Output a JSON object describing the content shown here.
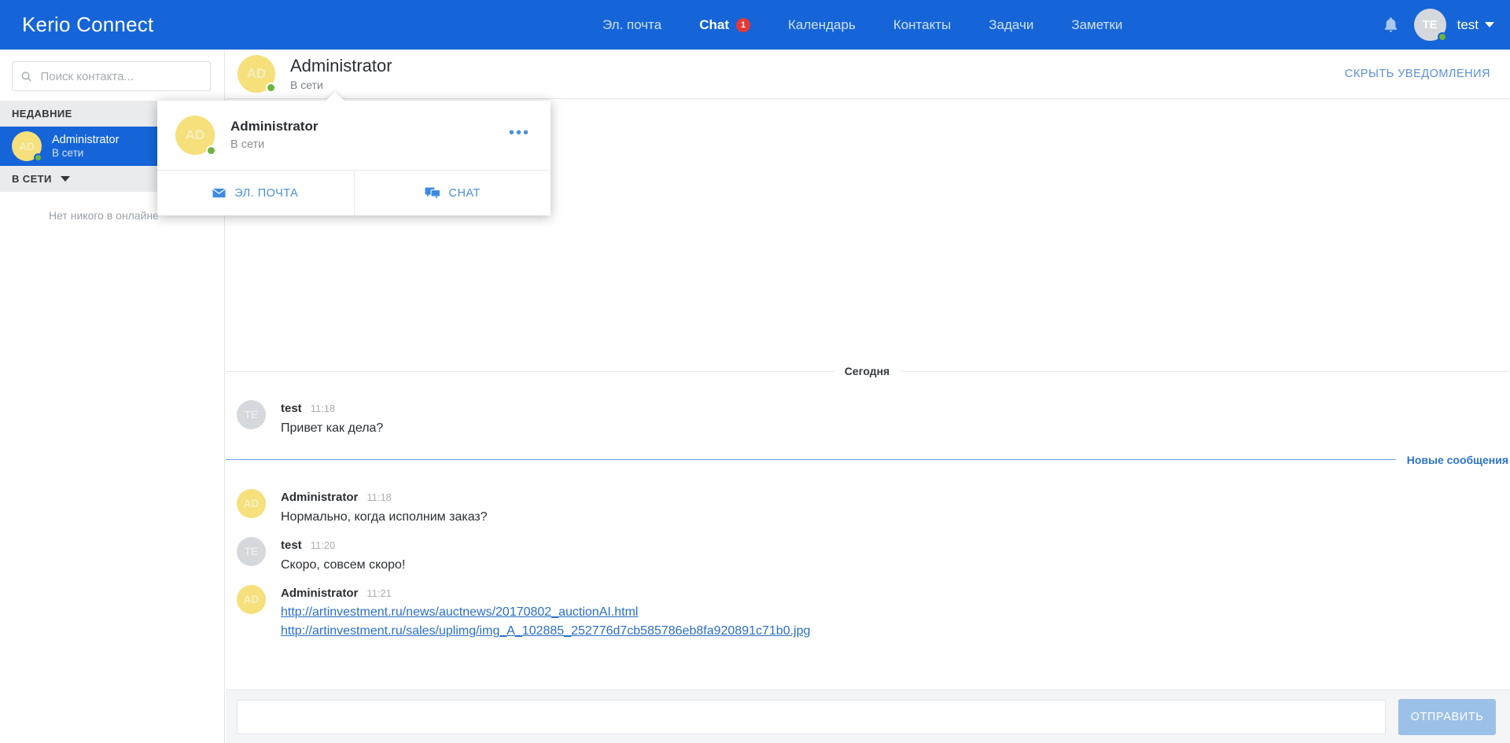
{
  "app": {
    "brand": "Kerio Connect"
  },
  "nav": {
    "items": [
      {
        "label": "Эл. почта",
        "active": false,
        "badge": ""
      },
      {
        "label": "Chat",
        "active": true,
        "badge": "1"
      },
      {
        "label": "Календарь",
        "active": false,
        "badge": ""
      },
      {
        "label": "Контакты",
        "active": false,
        "badge": ""
      },
      {
        "label": "Задачи",
        "active": false,
        "badge": ""
      },
      {
        "label": "Заметки",
        "active": false,
        "badge": ""
      }
    ],
    "bell_icon": "bell-icon",
    "user": {
      "initials": "TE",
      "name": "test",
      "status_color": "#6eb43f"
    }
  },
  "sidebar": {
    "search": {
      "placeholder": "Поиск контакта...",
      "value": "",
      "icon": "search-icon"
    },
    "sections": [
      {
        "title": "НЕДАВНИЕ",
        "collapsible": false,
        "contacts": [
          {
            "initials": "AD",
            "name": "Administrator",
            "status": "В сети",
            "selected": true
          }
        ]
      },
      {
        "title": "В СЕТИ",
        "collapsible": true,
        "empty_note": "Нет никого в онлайне",
        "contacts": []
      }
    ]
  },
  "chat_header": {
    "avatar_initials": "AD",
    "name": "Administrator",
    "status": "В сети",
    "hide_notifications": "СКРЫТЬ УВЕДОМЛЕНИЯ"
  },
  "popup_card": {
    "avatar_initials": "AD",
    "name": "Administrator",
    "status": "В сети",
    "more_icon": "ellipsis-icon",
    "actions": [
      {
        "label": "ЭЛ. ПОЧТА",
        "icon": "envelope-icon"
      },
      {
        "label": "CHAT",
        "icon": "chat-bubbles-icon"
      }
    ]
  },
  "conversation": {
    "date_divider": "Сегодня",
    "new_messages_divider": "Новые сообщения",
    "messages_before": [
      {
        "initials": "TE",
        "avatar_style": "grey",
        "author": "test",
        "time": "11:18",
        "text": "Привет как дела?",
        "links": []
      }
    ],
    "messages_after": [
      {
        "initials": "AD",
        "avatar_style": "yellow",
        "author": "Administrator",
        "time": "11:18",
        "text": "Нормально, когда исполним заказ?",
        "links": []
      },
      {
        "initials": "TE",
        "avatar_style": "grey",
        "author": "test",
        "time": "11:20",
        "text": "Скоро, совсем скоро!",
        "links": []
      },
      {
        "initials": "AD",
        "avatar_style": "yellow",
        "author": "Administrator",
        "time": "11:21",
        "text": "",
        "links": [
          "http://artinvestment.ru/news/auctnews/20170802_auctionAI.html",
          "http://artinvestment.ru/sales/uplimg/img_A_102885_252776d7cb585786eb8fa920891c71b0.jpg"
        ]
      }
    ]
  },
  "composer": {
    "placeholder": "",
    "value": "",
    "send_label": "ОТПРАВИТЬ"
  },
  "colors": {
    "brand_blue": "#1565d8",
    "badge_red": "#e53935",
    "online_green": "#6eb43f",
    "avatar_yellow": "#f6e07c",
    "avatar_grey": "#d5d8dc",
    "link_blue": "#2a6fc9",
    "send_button": "#9cc1e8"
  }
}
